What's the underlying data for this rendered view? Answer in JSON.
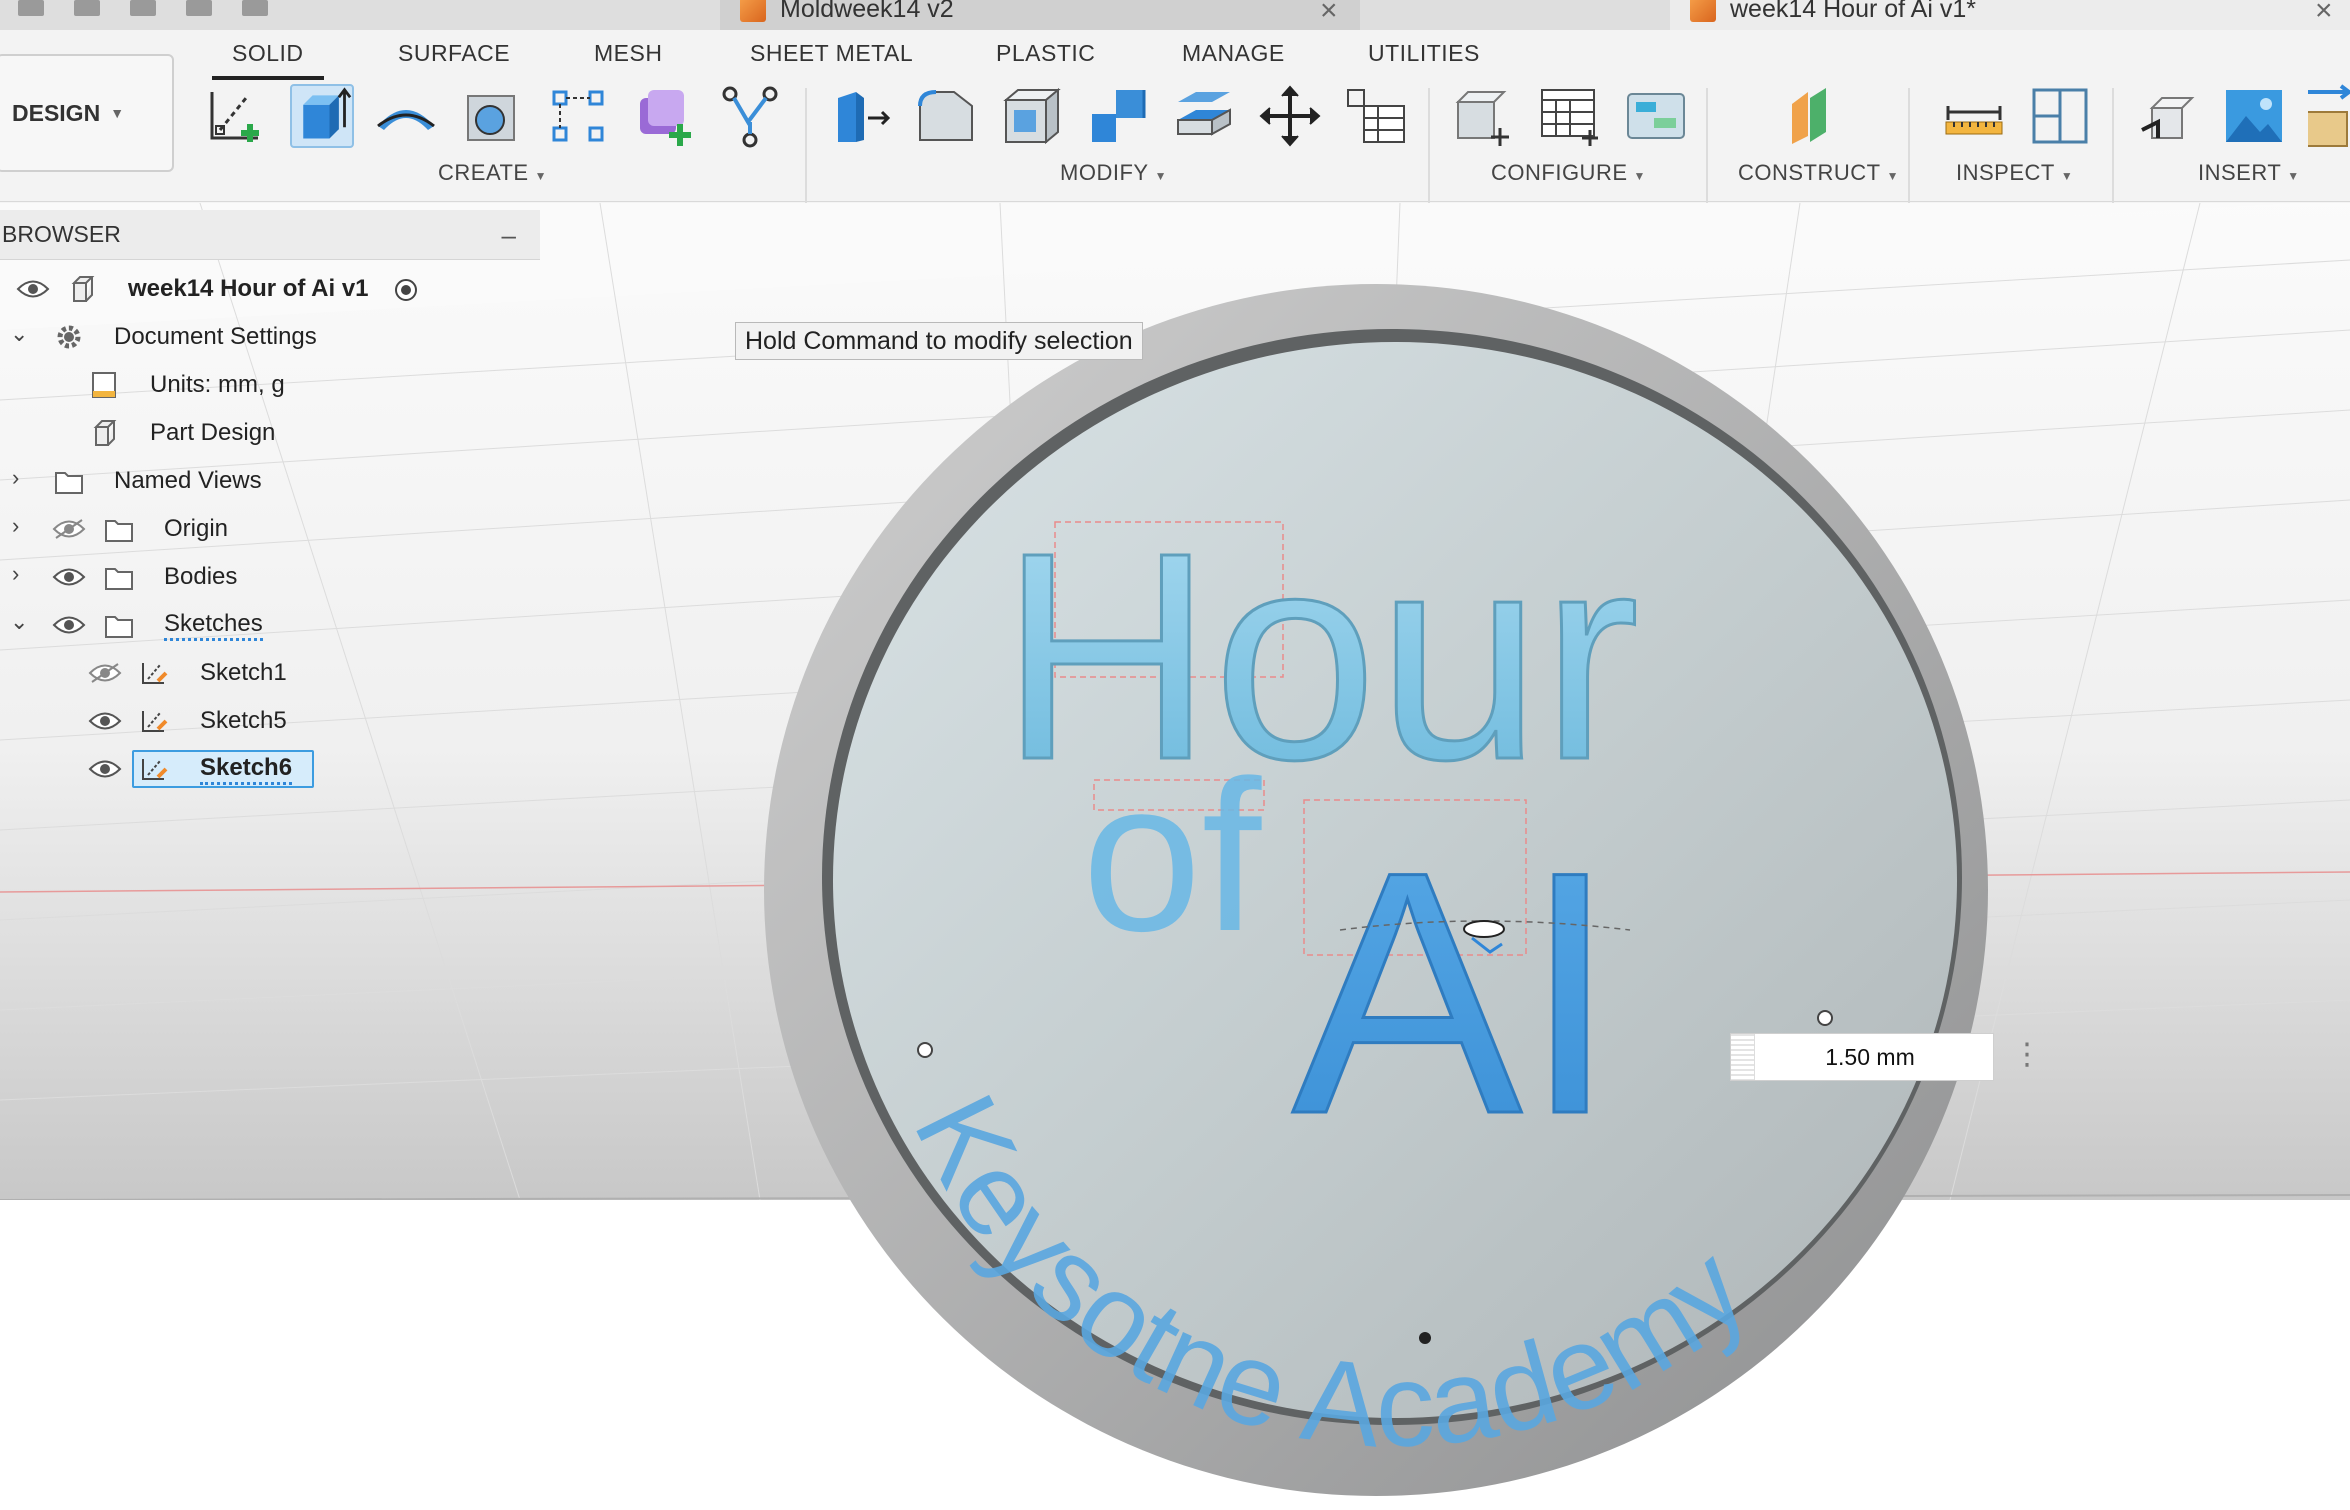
{
  "documents": {
    "tabs": [
      {
        "title": "Moldweek14 v2"
      },
      {
        "title": "week14 Hour of Ai v1*"
      }
    ]
  },
  "workspace": {
    "mode": "DESIGN",
    "tabs": [
      "SOLID",
      "SURFACE",
      "MESH",
      "SHEET METAL",
      "PLASTIC",
      "MANAGE",
      "UTILITIES"
    ],
    "active_tab": "SOLID"
  },
  "toolbar": {
    "groups": {
      "create": "CREATE",
      "modify": "MODIFY",
      "configure": "CONFIGURE",
      "construct": "CONSTRUCT",
      "inspect": "INSPECT",
      "insert": "INSERT"
    },
    "tools": [
      "create-sketch-icon",
      "extrude-icon",
      "revolve-icon",
      "sweep-icon",
      "loft-icon",
      "rectangular-pattern-icon",
      "new-component-icon",
      "form-icon",
      "press-pull-icon",
      "fillet-icon",
      "shell-icon",
      "combine-icon",
      "offset-face-icon",
      "move-icon",
      "parameters-table-icon",
      "configure-icon",
      "configuration-table-icon",
      "rule-icon",
      "plane-icon",
      "measure-icon",
      "section-analysis-icon",
      "insert-derive-icon",
      "insert-image-icon"
    ]
  },
  "browser": {
    "title": "BROWSER",
    "root": "week14 Hour of Ai v1",
    "items": [
      {
        "label": "Document Settings"
      },
      {
        "label": "Units: mm, g"
      },
      {
        "label": "Part Design"
      },
      {
        "label": "Named Views"
      },
      {
        "label": "Origin"
      },
      {
        "label": "Bodies"
      },
      {
        "label": "Sketches"
      },
      {
        "label": "Sketch1"
      },
      {
        "label": "Sketch5"
      },
      {
        "label": "Sketch6"
      }
    ]
  },
  "canvas": {
    "tooltip": "Hold Command to modify selection",
    "model_text": {
      "line1": "Hour",
      "line2a": "of",
      "line2b": "AI",
      "arc": "Keysotne Academy"
    },
    "dimension_value": "1.50 mm",
    "colors": {
      "text_blue": "#4a9fde",
      "light_blue": "#8fcde6",
      "coin_face": "#c9d2d4",
      "rim": "#a7a9ab"
    }
  }
}
